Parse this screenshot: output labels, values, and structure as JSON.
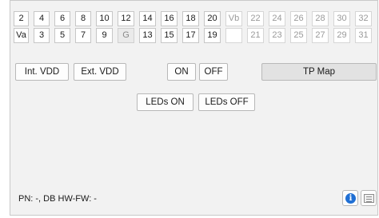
{
  "pins": {
    "row1": [
      {
        "label": "2",
        "state": "on"
      },
      {
        "label": "4",
        "state": "on"
      },
      {
        "label": "6",
        "state": "on"
      },
      {
        "label": "8",
        "state": "on"
      },
      {
        "label": "10",
        "state": "on"
      },
      {
        "label": "12",
        "state": "on"
      },
      {
        "label": "14",
        "state": "on"
      },
      {
        "label": "16",
        "state": "on"
      },
      {
        "label": "18",
        "state": "on"
      },
      {
        "label": "20",
        "state": "on"
      },
      {
        "label": "Vb",
        "state": "disabled"
      },
      {
        "label": "22",
        "state": "disabled"
      },
      {
        "label": "24",
        "state": "disabled"
      },
      {
        "label": "26",
        "state": "disabled"
      },
      {
        "label": "28",
        "state": "disabled"
      },
      {
        "label": "30",
        "state": "disabled"
      },
      {
        "label": "32",
        "state": "disabled"
      }
    ],
    "row2": [
      {
        "label": "Va",
        "state": "on"
      },
      {
        "label": "3",
        "state": "on"
      },
      {
        "label": "5",
        "state": "on"
      },
      {
        "label": "7",
        "state": "on"
      },
      {
        "label": "9",
        "state": "on"
      },
      {
        "label": "G",
        "state": "ground"
      },
      {
        "label": "13",
        "state": "on"
      },
      {
        "label": "15",
        "state": "on"
      },
      {
        "label": "17",
        "state": "on"
      },
      {
        "label": "19",
        "state": "on"
      },
      {
        "label": "",
        "state": "blank"
      },
      {
        "label": "21",
        "state": "disabled"
      },
      {
        "label": "23",
        "state": "disabled"
      },
      {
        "label": "25",
        "state": "disabled"
      },
      {
        "label": "27",
        "state": "disabled"
      },
      {
        "label": "29",
        "state": "disabled"
      },
      {
        "label": "31",
        "state": "disabled"
      }
    ]
  },
  "buttons": {
    "int_vdd": "Int. VDD",
    "ext_vdd": "Ext. VDD",
    "on": "ON",
    "off": "OFF",
    "tp_map": "TP Map",
    "leds_on": "LEDs ON",
    "leds_off": "LEDs OFF"
  },
  "footer": {
    "status": "PN: -, DB HW-FW: -",
    "info_icon": "info-icon",
    "list_icon": "list-icon"
  },
  "colors": {
    "panel": "#f2f2f2",
    "info_blue": "#1f6fd4"
  }
}
